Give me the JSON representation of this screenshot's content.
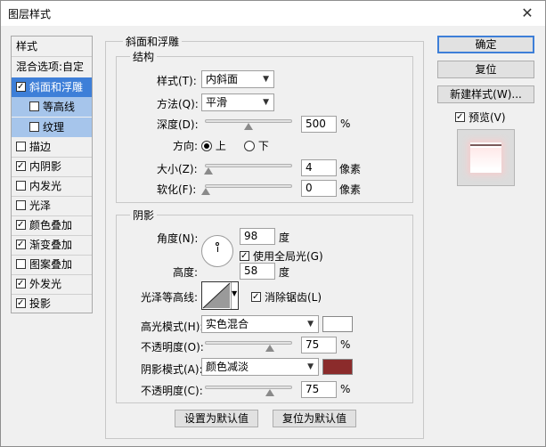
{
  "window": {
    "title": "图层样式"
  },
  "stylelist": {
    "header": "样式",
    "blend": "混合选项:自定",
    "items": [
      {
        "label": "斜面和浮雕",
        "checked": true
      },
      {
        "label": "等高线",
        "checked": false
      },
      {
        "label": "纹理",
        "checked": false
      },
      {
        "label": "描边",
        "checked": false
      },
      {
        "label": "内阴影",
        "checked": true
      },
      {
        "label": "内发光",
        "checked": false
      },
      {
        "label": "光泽",
        "checked": false
      },
      {
        "label": "颜色叠加",
        "checked": true
      },
      {
        "label": "渐变叠加",
        "checked": true
      },
      {
        "label": "图案叠加",
        "checked": false
      },
      {
        "label": "外发光",
        "checked": true
      },
      {
        "label": "投影",
        "checked": true
      }
    ]
  },
  "bevel": {
    "title": "斜面和浮雕",
    "structure": {
      "title": "结构",
      "style_label": "样式(T):",
      "style_value": "内斜面",
      "method_label": "方法(Q):",
      "method_value": "平滑",
      "depth_label": "深度(D):",
      "depth_value": "500",
      "depth_unit": "%",
      "depth_level": 0.5,
      "direction_label": "方向:",
      "dir_up": "上",
      "dir_down": "下",
      "size_label": "大小(Z):",
      "size_value": "4",
      "size_unit": "像素",
      "soften_label": "软化(F):",
      "soften_value": "0",
      "soften_unit": "像素"
    },
    "shading": {
      "title": "阴影",
      "angle_label": "角度(N):",
      "angle_value": "98",
      "angle_unit": "度",
      "global_light": "使用全局光(G)",
      "altitude_label": "高度:",
      "altitude_value": "58",
      "altitude_unit": "度",
      "gloss_label": "光泽等高线:",
      "antialias": "消除锯齿(L)",
      "highlight_mode_label": "高光模式(H):",
      "highlight_mode_value": "实色混合",
      "highlight_color": "#ffffff",
      "opacity1_label": "不透明度(O):",
      "opacity1_value": "75",
      "opacity_unit": "%",
      "shadow_mode_label": "阴影模式(A):",
      "shadow_mode_value": "颜色减淡",
      "shadow_color": "#8b2b2b",
      "opacity2_label": "不透明度(C):",
      "opacity2_value": "75"
    },
    "make_default": "设置为默认值",
    "reset_default": "复位为默认值"
  },
  "buttons": {
    "ok": "确定",
    "reset": "复位",
    "new_style": "新建样式(W)...",
    "preview": "预览(V)"
  }
}
